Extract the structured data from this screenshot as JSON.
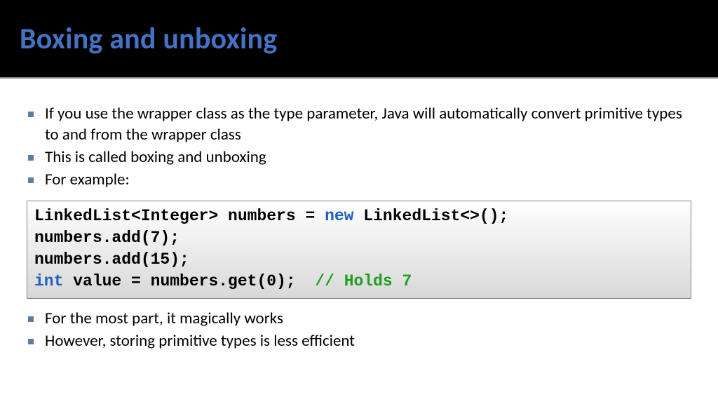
{
  "title": "Boxing and unboxing",
  "bullets_top": [
    "If you use the wrapper class as the type parameter, Java will automatically convert primitive types to and from the wrapper class",
    "This is called boxing and unboxing",
    "For example:"
  ],
  "code": {
    "l1a": "LinkedList<Integer> numbers = ",
    "l1_new": "new",
    "l1b": " LinkedList<>();",
    "l2": "numbers.add(7);",
    "l3": "numbers.add(15);",
    "l4_int": "int",
    "l4a": " value = numbers.get(0);  ",
    "l4_comment": "// Holds 7"
  },
  "bullets_bottom": [
    "For the most part, it magically works",
    "However, storing primitive types is less efficient"
  ]
}
